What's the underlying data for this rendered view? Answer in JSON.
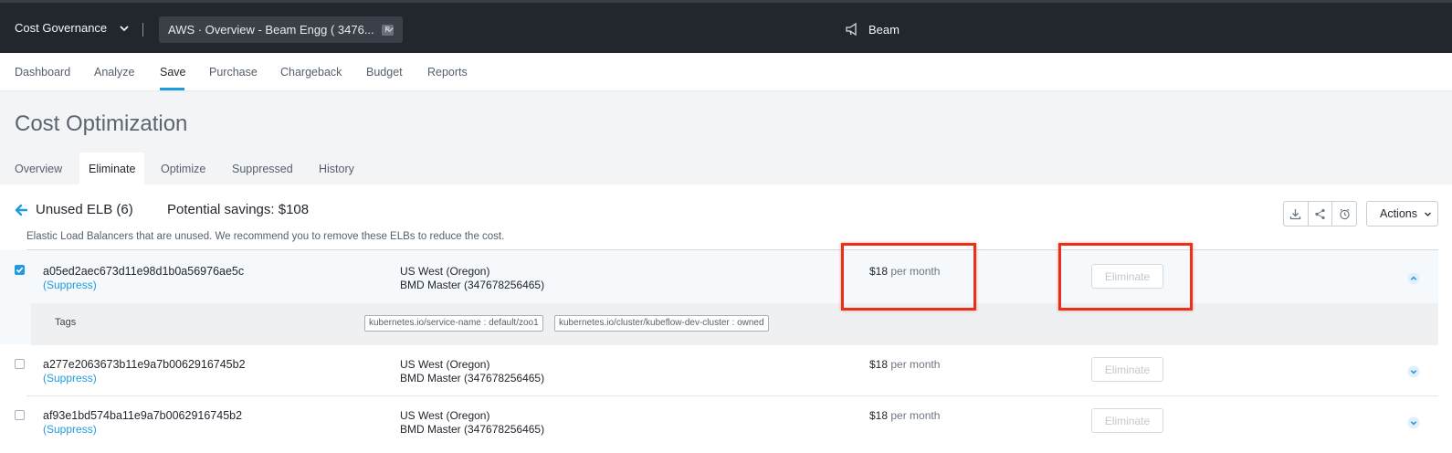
{
  "topbar": {
    "app_name": "Cost Governance",
    "context": "AWS · Overview - Beam Engg ( 3476...",
    "context_badge": "P",
    "brand": "Beam"
  },
  "nav": {
    "items": [
      "Dashboard",
      "Analyze",
      "Save",
      "Purchase",
      "Chargeback",
      "Budget",
      "Reports"
    ],
    "active": "Save"
  },
  "page": {
    "title": "Cost Optimization",
    "tabs": [
      "Overview",
      "Eliminate",
      "Optimize",
      "Suppressed",
      "History"
    ],
    "active_tab": "Eliminate"
  },
  "section": {
    "title": "Unused ELB (6)",
    "savings": "Potential savings: $108",
    "description": "Elastic Load Balancers that are unused. We recommend you to remove these ELBs to reduce the cost.",
    "actions_label": "Actions",
    "icon_buttons": [
      "download-icon",
      "share-icon",
      "schedule-icon"
    ]
  },
  "rows": [
    {
      "name": "a05ed2aec673d11e98d1b0a56976ae5c",
      "suppress": "(Suppress)",
      "region": "US West (Oregon)",
      "account": "BMD Master (347678256465)",
      "cost": "$18",
      "per": "per month",
      "action": "Eliminate",
      "checked": true,
      "expanded": true,
      "tags_label": "Tags",
      "tags": [
        "kubernetes.io/service-name : default/zoo1",
        "kubernetes.io/cluster/kubeflow-dev-cluster : owned"
      ]
    },
    {
      "name": "a277e2063673b11e9a7b0062916745b2",
      "suppress": "(Suppress)",
      "region": "US West (Oregon)",
      "account": "BMD Master (347678256465)",
      "cost": "$18",
      "per": "per month",
      "action": "Eliminate",
      "checked": false,
      "expanded": false
    },
    {
      "name": "af93e1bd574ba11e9a7b0062916745b2",
      "suppress": "(Suppress)",
      "region": "US West (Oregon)",
      "account": "BMD Master (347678256465)",
      "cost": "$18",
      "per": "per month",
      "action": "Eliminate",
      "checked": false,
      "expanded": false
    }
  ],
  "colors": {
    "accent": "#1f9bde",
    "topbar": "#22272e",
    "highlight": "#e8311a"
  }
}
